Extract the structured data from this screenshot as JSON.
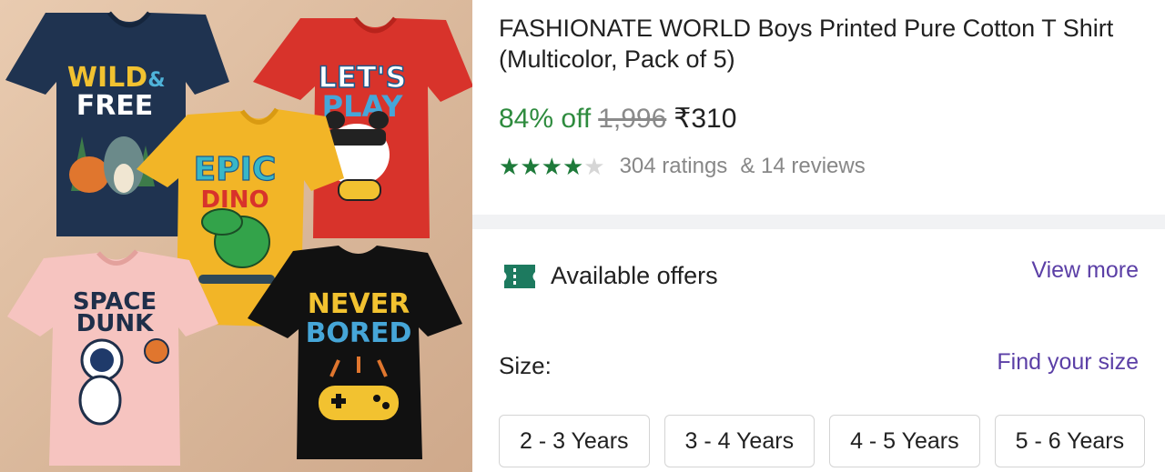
{
  "product": {
    "title": "FASHIONATE WORLD Boys Printed Pure Cotton T Shirt (Multicolor, Pack of 5)",
    "discount": "84% off",
    "mrp": "1,996",
    "price": "₹310",
    "rating_stars": 4,
    "ratings_text": "304 ratings",
    "reviews_text": "& 14 reviews"
  },
  "image": {
    "shirts": [
      {
        "line1": "WILD",
        "amp": "&",
        "line2": "FREE",
        "color": "#1f3350"
      },
      {
        "line1": "LET'S",
        "line2": "PLAY",
        "color": "#d8332b"
      },
      {
        "line1": "EPIC",
        "line2": "DINO",
        "color": "#f2b527"
      },
      {
        "line1": "SPACE",
        "line2": "DUNK",
        "color": "#f6c4c0"
      },
      {
        "line1": "NEVER",
        "line2": "BORED",
        "color": "#111111"
      }
    ]
  },
  "offers": {
    "icon": "ticket-icon",
    "label": "Available offers",
    "view_more": "View more"
  },
  "size": {
    "label": "Size:",
    "find_size": "Find your size",
    "options": [
      "2 - 3 Years",
      "3 - 4 Years",
      "4 - 5 Years",
      "5 - 6 Years"
    ]
  },
  "colors": {
    "discount_green": "#2e8b3e",
    "star_green": "#1e7a3a",
    "link_purple": "#5b3fa6"
  }
}
